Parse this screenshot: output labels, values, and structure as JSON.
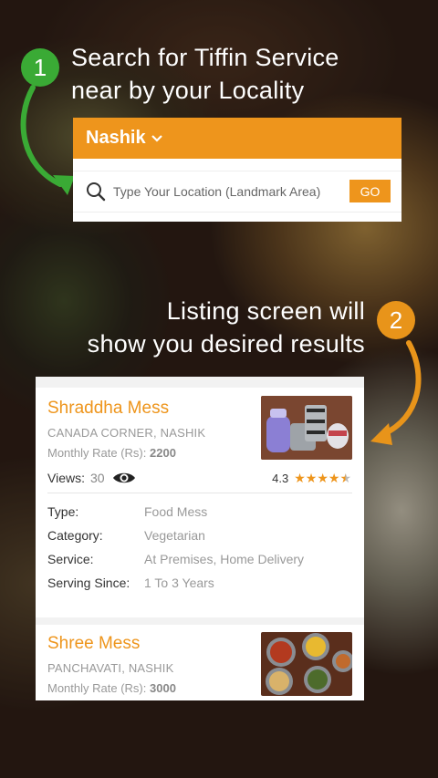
{
  "step1": {
    "number": "1",
    "headline_line1": "Search for Tiffin Service",
    "headline_line2": "near by your Locality"
  },
  "search": {
    "city": "Nashik",
    "placeholder": "Type Your Location (Landmark Area)",
    "go_label": "GO"
  },
  "step2": {
    "number": "2",
    "headline_line1": "Listing screen will",
    "headline_line2": "show you desired results"
  },
  "listings": [
    {
      "name": "Shraddha Mess",
      "location": "CANADA CORNER, NASHIK",
      "rate_label": "Monthly Rate (Rs):",
      "rate_value": "2200",
      "views_label": "Views:",
      "views_count": "30",
      "rating": "4.3",
      "rating_value": 4.3,
      "details": [
        {
          "label": "Type:",
          "value": "Food Mess"
        },
        {
          "label": "Category:",
          "value": "Vegetarian"
        },
        {
          "label": "Service:",
          "value": "At Premises, Home Delivery"
        },
        {
          "label": "Serving Since:",
          "value": "1 To 3 Years"
        }
      ]
    },
    {
      "name": "Shree Mess",
      "location": "PANCHAVATI, NASHIK",
      "rate_label": "Monthly Rate (Rs):",
      "rate_value": "3000"
    }
  ],
  "colors": {
    "accent": "#ee951c",
    "step1": "#3aaa35",
    "step2": "#e8941a"
  },
  "icons": [
    "search-icon",
    "chevron-down-icon",
    "eye-icon",
    "star-icon",
    "arrow-icon"
  ]
}
